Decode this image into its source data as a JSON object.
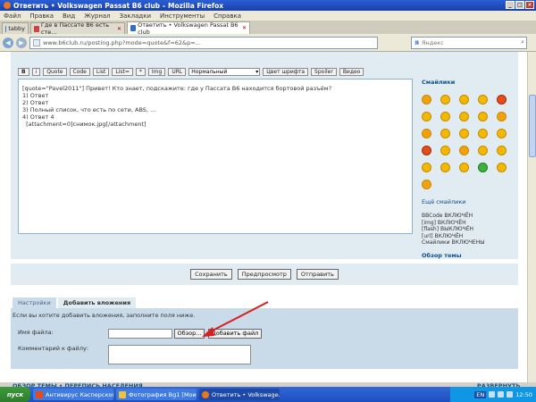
{
  "window": {
    "title": "Ответить • Volkswagen Passat B6 club – Mozilla Firefox",
    "min": "_",
    "max": "□",
    "close": "×"
  },
  "menu": [
    "Файл",
    "Правка",
    "Вид",
    "Журнал",
    "Закладки",
    "Инструменты",
    "Справка"
  ],
  "tabs": [
    {
      "label": "tabby"
    },
    {
      "label": "Где в Пассате В6 есть сте..."
    },
    {
      "label": "Ответить • Volkswagen Passat B6 club"
    }
  ],
  "nav": {
    "url": "www.b6club.ru/posting.php?mode=quote&f=62&p=...",
    "search_placeholder": "Яндекс"
  },
  "toolbar": {
    "buttons": [
      "B",
      "i",
      "Quote",
      "Code",
      "List",
      "List=",
      "*",
      "Img",
      "URL"
    ],
    "font_size": "Нормальный",
    "color_button": "Цвет шрифта",
    "spoiler": "Spoiler",
    "video": "Видео"
  },
  "editor": {
    "lines": [
      "[quote=\"Pavel2011\"] Привет! Кто знает, подскажите: где у Пассата B6 находится бортовой разъём?",
      "",
      "1) Ответ",
      "2) Ответ",
      "3) Полный список, что есть по сети, ABS, ...",
      "4) Ответ 4",
      "",
      "  [attachment=0]снимок.jpg[/attachment]"
    ]
  },
  "smilies": {
    "header": "Смайлики",
    "more": "Ещё смайлики",
    "bbcode": [
      "BBCode ВКЛЮЧЁН",
      "[img] ВКЛЮЧЁН",
      "[flash] ВЫКЛЮЧЁН",
      "[url] ВКЛЮЧЁН",
      "Смайлики ВКЛЮЧЕНЫ"
    ],
    "topic_review": "Обзор темы"
  },
  "submit": {
    "save": "Сохранить",
    "preview": "Предпросмотр",
    "send": "Отправить"
  },
  "lower_tabs": [
    "Настройки",
    "Добавить вложения"
  ],
  "attach": {
    "info": "Если вы хотите добавить вложения, заполните поля ниже.",
    "file_label": "Имя файла:",
    "browse": "Обзор...",
    "add_file": "Добавить файл",
    "comment_label": "Комментарий к файлу:"
  },
  "footer": {
    "left": "ОБЗОР ТЕМЫ • ПЕРЕПИСЬ НАСЕЛЕНИЯ",
    "right": "РАЗВЕРНУТЬ"
  },
  "taskbar": {
    "start": "пуск",
    "tasks": [
      "Антивирус Касперского",
      "Фотография Bg1 [Мои...",
      "Ответить • Volkswage..."
    ],
    "lang": "EN",
    "time": "12:50"
  },
  "colors": {
    "panel": "#e1ebf2",
    "attach_panel": "#c9dbe9",
    "link": "#105289",
    "annotation_arrow": "#d81e1e"
  }
}
